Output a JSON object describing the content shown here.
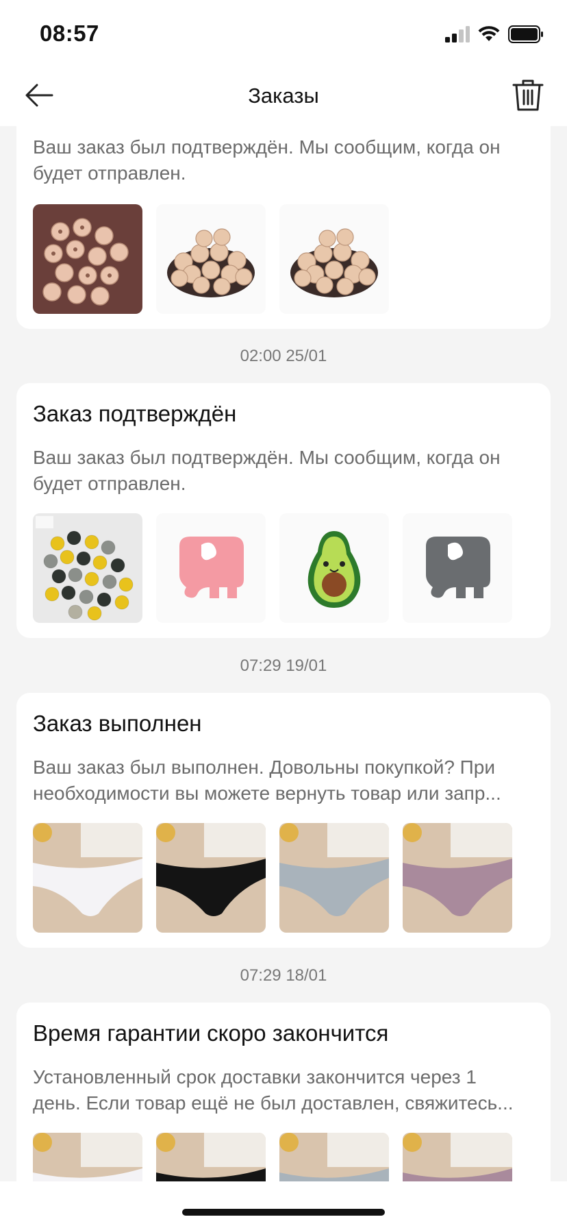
{
  "status_bar": {
    "time": "08:57"
  },
  "header": {
    "title": "Заказы"
  },
  "orders": [
    {
      "title": "",
      "text_lines": [
        "Ваш заказ был подтверждён. Мы сообщим, когда он",
        "будет отправлен."
      ]
    },
    {
      "timestamp": "02:00 25/01",
      "title": "Заказ подтверждён",
      "text_lines": [
        "Ваш заказ был подтверждён. Мы сообщим, когда он",
        "будет отправлен."
      ]
    },
    {
      "timestamp": "07:29 19/01",
      "title": "Заказ выполнен",
      "text_lines": [
        "Ваш заказ был выполнен. Довольны покупкой? При",
        "необходимости вы можете вернуть товар или запр..."
      ]
    },
    {
      "timestamp": "07:29 18/01",
      "title": "Время гарантии скоро закончится",
      "text_lines": [
        "Установленный срок доставки закончится через 1",
        "день. Если товар ещё не был доставлен, свяжитесь..."
      ]
    }
  ],
  "colors": {
    "background": "#f4f4f4",
    "card": "#ffffff",
    "text_secondary": "#6b6b6b"
  }
}
